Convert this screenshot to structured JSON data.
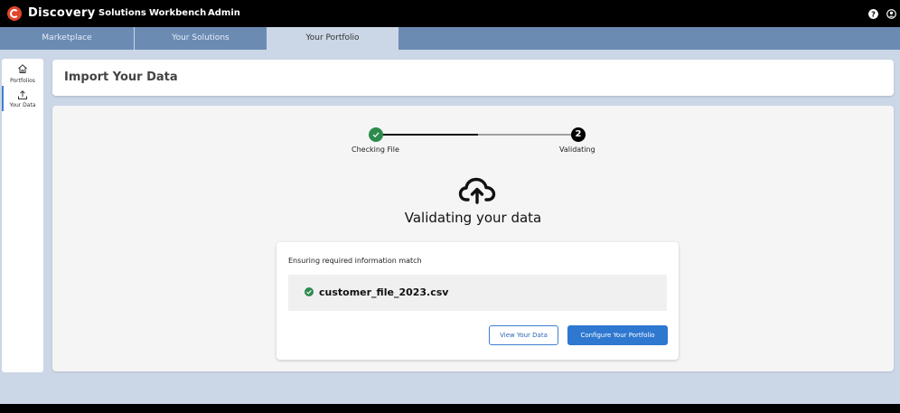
{
  "app": {
    "name": "Discovery",
    "brand_color": "#e0462b"
  },
  "topnav": {
    "items": [
      "Solutions",
      "Workbench",
      "Admin"
    ]
  },
  "topbar_icons": [
    "help-icon",
    "account-icon"
  ],
  "tabs": [
    {
      "label": "Marketplace",
      "active": false
    },
    {
      "label": "Your Solutions",
      "active": false
    },
    {
      "label": "Your Portfolio",
      "active": true
    }
  ],
  "sidenav": {
    "items": [
      {
        "label": "Portfolios",
        "icon": "home-icon",
        "active": false
      },
      {
        "label": "Your Data",
        "icon": "upload-icon",
        "active": true
      }
    ]
  },
  "page": {
    "title": "Import Your Data"
  },
  "stepper": {
    "steps": [
      {
        "label": "Checking File",
        "state": "complete"
      },
      {
        "label": "Validating",
        "state": "current",
        "number": "2"
      }
    ]
  },
  "status": {
    "title": "Validating your data",
    "icon": "cloud-upload-icon"
  },
  "validation": {
    "subtitle": "Ensuring required information match",
    "file_name": "customer_file_2023.csv",
    "file_status": "valid"
  },
  "actions": {
    "view_label": "View Your Data",
    "configure_label": "Configure Your Portfolio"
  },
  "colors": {
    "accent": "#2e78d0",
    "success": "#2e8b4e",
    "tab_bar": "#6b8bb3",
    "tab_active": "#cbd7e6"
  }
}
